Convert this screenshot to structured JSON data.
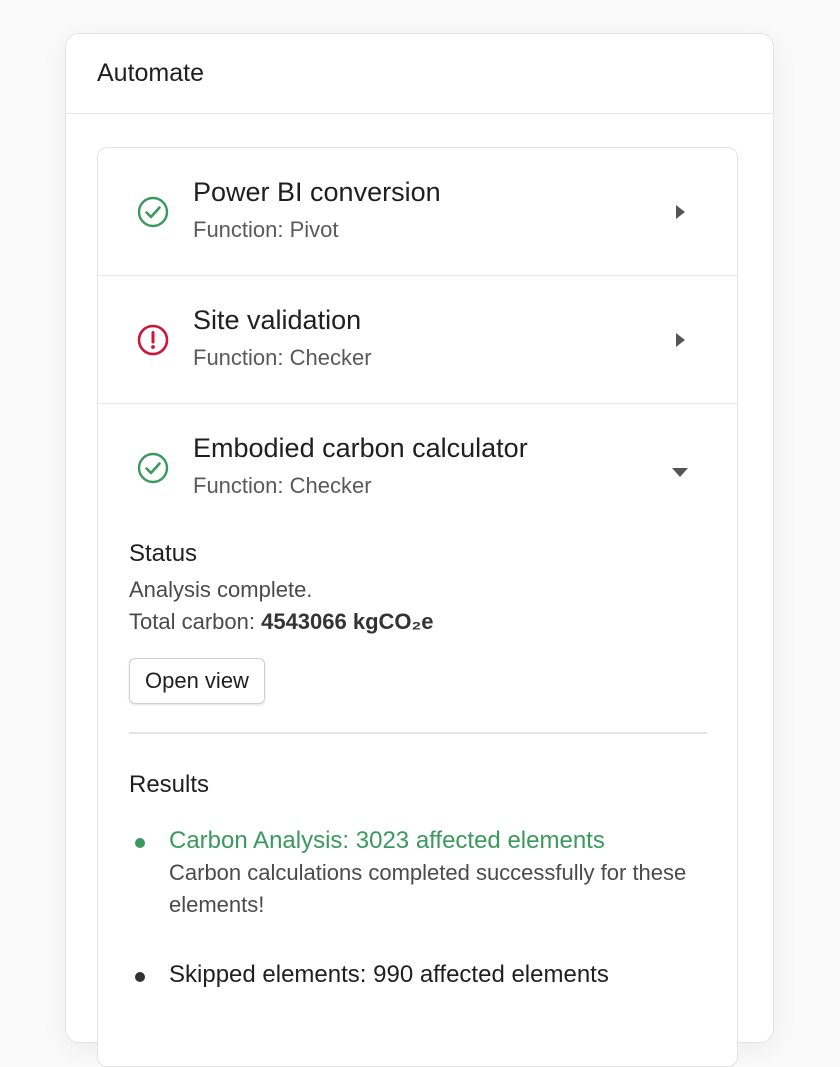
{
  "panel": {
    "title": "Automate"
  },
  "colors": {
    "success": "#3a9a5e",
    "error": "#d0143a",
    "neutral": "#333333"
  },
  "functions": [
    {
      "title": "Power BI conversion",
      "subtitle": "Function: Pivot",
      "status_icon": "check-circle-icon",
      "caret_icon": "caret-right-icon"
    },
    {
      "title": "Site validation",
      "subtitle": "Function: Checker",
      "status_icon": "alert-circle-icon",
      "caret_icon": "caret-right-icon"
    },
    {
      "title": "Embodied carbon calculator",
      "subtitle": "Function: Checker",
      "status_icon": "check-circle-icon",
      "caret_icon": "caret-down-icon"
    }
  ],
  "details": {
    "status_title": "Status",
    "status_text": "Analysis complete.",
    "total_label": "Total carbon:",
    "total_value": "4543066 kgCO₂e",
    "open_view_label": "Open view",
    "results_title": "Results",
    "results": [
      {
        "title": "Carbon Analysis: 3023 affected elements",
        "description": "Carbon calculations completed successfully for these elements!",
        "level": "success"
      },
      {
        "title": "Skipped elements: 990 affected elements",
        "description": "",
        "level": "neutral"
      }
    ]
  }
}
